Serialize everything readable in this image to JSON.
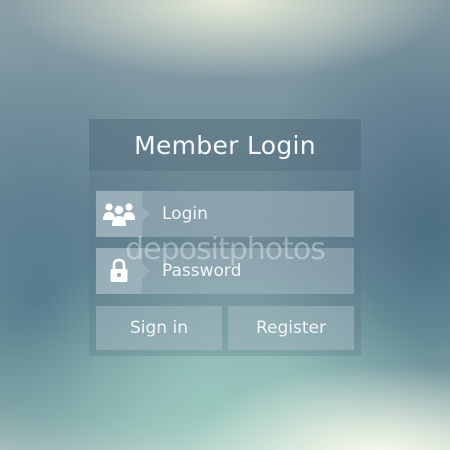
{
  "form": {
    "title": "Member Login",
    "login_field": {
      "placeholder": "Login",
      "icon": "users-icon"
    },
    "password_field": {
      "placeholder": "Password",
      "icon": "padlock-icon"
    },
    "sign_in_label": "Sign in",
    "register_label": "Register"
  },
  "watermark": "depositphotos",
  "colors": {
    "text": "#f2f6f6",
    "background_top": "#8ba0a6",
    "background_bottom": "#c9dcd2"
  }
}
